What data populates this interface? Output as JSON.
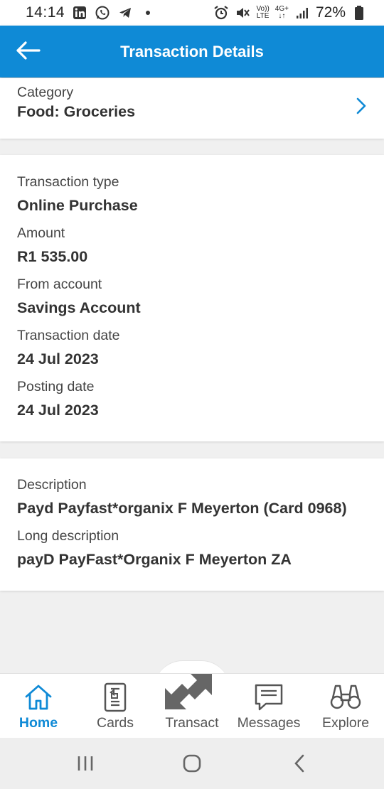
{
  "status_bar": {
    "time": "14:14",
    "icons_left": [
      "linkedin-icon",
      "whatsapp-icon",
      "telegram-icon",
      "dot-icon"
    ],
    "icons_right": [
      "alarm-icon",
      "mute-icon",
      "volte-icon",
      "4g-icon",
      "signal-icon",
      "battery-icon"
    ],
    "volte_top": "Vo))",
    "volte_bottom": "LTE",
    "net_top": "4G+",
    "net_bottom": "↓↑",
    "battery": "72%"
  },
  "header": {
    "title": "Transaction Details",
    "background": "#0f8ad6"
  },
  "category": {
    "label": "Category",
    "value": "Food: Groceries"
  },
  "details": [
    {
      "label": "Transaction type",
      "value": "Online Purchase"
    },
    {
      "label": "Amount",
      "value": "R1 535.00"
    },
    {
      "label": "From account",
      "value": "Savings Account"
    },
    {
      "label": "Transaction date",
      "value": "24 Jul 2023"
    },
    {
      "label": "Posting date",
      "value": "24 Jul 2023"
    }
  ],
  "description": [
    {
      "label": "Description",
      "value": "Payd Payfast*organix F Meyerton (Card 0968)"
    },
    {
      "label": "Long description",
      "value": "payD PayFast*Organix F Meyerton ZA"
    }
  ],
  "bottom_nav": {
    "items": [
      {
        "label": "Home",
        "icon": "home-icon",
        "active": true
      },
      {
        "label": "Cards",
        "icon": "card-icon",
        "active": false
      },
      {
        "label": "Transact",
        "icon": "transact-arrows-icon",
        "active": false
      },
      {
        "label": "Messages",
        "icon": "message-icon",
        "active": false
      },
      {
        "label": "Explore",
        "icon": "binoculars-icon",
        "active": false
      }
    ],
    "active_color": "#0f8ad6"
  },
  "system_nav": [
    "recents-icon",
    "home-circle-icon",
    "back-chevron-icon"
  ]
}
